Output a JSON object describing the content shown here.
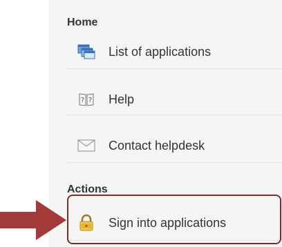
{
  "sections": {
    "home": {
      "title": "Home"
    },
    "actions": {
      "title": "Actions"
    }
  },
  "items": [
    {
      "label": "List of applications",
      "icon": "windows-stack-icon"
    },
    {
      "label": "Help",
      "icon": "help-book-icon"
    },
    {
      "label": "Contact helpdesk",
      "icon": "envelope-icon"
    },
    {
      "label": "Sign into applications",
      "icon": "padlock-icon"
    }
  ],
  "colors": {
    "highlight_border": "#7e2d2d",
    "arrow": "#a33a3a"
  }
}
